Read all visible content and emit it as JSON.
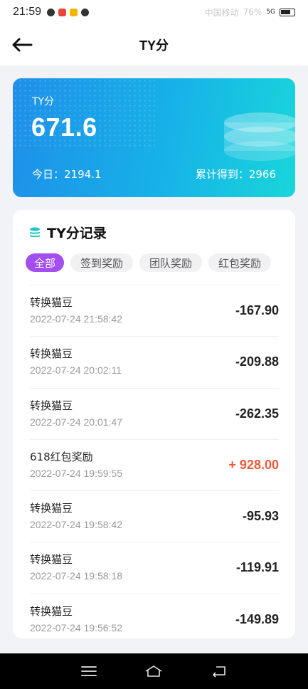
{
  "status_bar": {
    "time": "21:59",
    "carrier": "中国移动",
    "battery": "76%",
    "network": "5G"
  },
  "navbar": {
    "title": "TY分"
  },
  "summary": {
    "label": "TY分",
    "value": "671.6",
    "today": "今日：2194.1",
    "total": "累计得到：2966"
  },
  "records": {
    "title": "TY分记录",
    "tabs": [
      "全部",
      "签到奖励",
      "团队奖励",
      "红包奖励"
    ],
    "items": [
      {
        "name": "转换猫豆",
        "time": "2022-07-24  21:58:42",
        "amount": "-167.90"
      },
      {
        "name": "转换猫豆",
        "time": "2022-07-24  20:02:11",
        "amount": "-209.88"
      },
      {
        "name": "转换猫豆",
        "time": "2022-07-24  20:01:47",
        "amount": "-262.35"
      },
      {
        "name": "618红包奖励",
        "time": "2022-07-24  19:59:55",
        "amount": "+ 928.00"
      },
      {
        "name": "转换猫豆",
        "time": "2022-07-24  19:58:42",
        "amount": "-95.93"
      },
      {
        "name": "转换猫豆",
        "time": "2022-07-24  19:58:18",
        "amount": "-119.91"
      },
      {
        "name": "转换猫豆",
        "time": "2022-07-24  19:56:52",
        "amount": "-149.89"
      }
    ]
  },
  "colors": {
    "accent": "#a34ef0",
    "positive": "#ef5a3a",
    "card_start": "#1e8fe9",
    "card_end": "#18d6da"
  },
  "icons": {
    "back": "arrow-left-icon",
    "records": "stack-icon",
    "menu": "menu-icon",
    "home": "home-icon",
    "return": "return-icon"
  }
}
